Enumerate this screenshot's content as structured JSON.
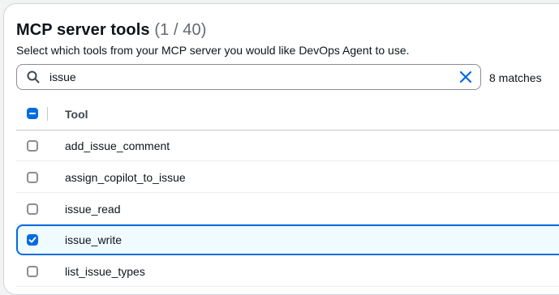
{
  "section": {
    "title": "MCP server tools",
    "count": "(1 / 40)",
    "description": "Select which tools from your MCP server you would like DevOps Agent to use."
  },
  "search": {
    "value": "issue",
    "icon": "search-icon",
    "clear_icon": "close-icon",
    "match_text": "8 matches"
  },
  "table": {
    "column_header": "Tool",
    "select_all_state": "indeterminate",
    "rows": [
      {
        "name": "add_issue_comment",
        "checked": false
      },
      {
        "name": "assign_copilot_to_issue",
        "checked": false
      },
      {
        "name": "issue_read",
        "checked": false
      },
      {
        "name": "issue_write",
        "checked": true
      },
      {
        "name": "list_issue_types",
        "checked": false
      }
    ]
  },
  "colors": {
    "accent": "#006ce0",
    "selected_row_bg": "#f0fbff",
    "border": "#8c8c94"
  }
}
